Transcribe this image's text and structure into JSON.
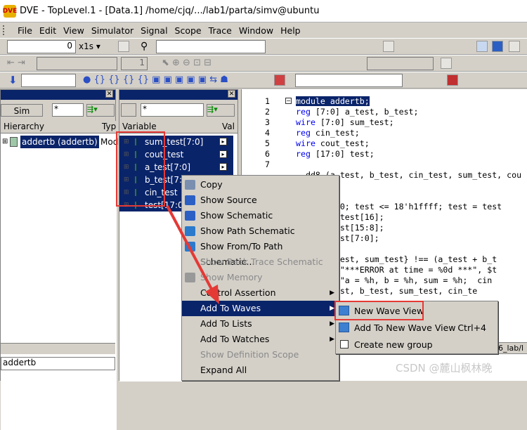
{
  "window": {
    "title": "DVE - TopLevel.1 - [Data.1]  /home/cjq/.../lab1/parta/simv@ubuntu",
    "logo": "DVE"
  },
  "menubar": [
    "File",
    "Edit",
    "View",
    "Simulator",
    "Signal",
    "Scope",
    "Trace",
    "Window",
    "Help"
  ],
  "toolbar1": {
    "time_value": "0",
    "time_unit": "x1s"
  },
  "toolbar2": {
    "step_value": "1"
  },
  "hierarchy": {
    "sim_label": "Sim",
    "filter": "*",
    "col_hierarchy": "Hierarchy",
    "col_type": "Typ",
    "row_name": "addertb (addertb)",
    "row_type": "Mod",
    "bottom_value": "addertb"
  },
  "variables": {
    "filter": "*",
    "col_variable": "Variable",
    "col_value": "Val",
    "rows": [
      "sum_test[7:0]",
      "cout_test",
      "a_test[7:0]",
      "b_test[7:0]",
      "cin_test",
      "test[17:0]"
    ]
  },
  "source": {
    "line_numbers": [
      "1",
      "2",
      "3",
      "4",
      "5",
      "6",
      "7"
    ],
    "lines": [
      {
        "kw": "",
        "text": "module addertb;"
      },
      {
        "kw": "reg",
        "text": " [7:0] a_test, b_test;"
      },
      {
        "kw": "wire",
        "text": " [7:0] sum_test;"
      },
      {
        "kw": "reg",
        "text": " cin_test;"
      },
      {
        "kw": "wire",
        "text": " cout_test;"
      },
      {
        "kw": "reg",
        "text": " [17:0] test;"
      },
      {
        "kw": "",
        "text": ""
      },
      {
        "kw": "",
        "text": "  dd8 (a_test, b_test, cin_test, sum_test, cou"
      },
      {
        "kw": "",
        "text": ""
      },
      {
        "kw": "",
        "text": ""
      },
      {
        "kw": "",
        "text": "   est = 0; test <= 18'h1ffff; test = test"
      },
      {
        "kw": "",
        "text": "   est = test[16];"
      },
      {
        "kw": "",
        "text": "   t = test[15:8];"
      },
      {
        "kw": "",
        "text": "   t = test[7:0];"
      },
      {
        "kw": "",
        "text": ""
      },
      {
        "kw": "",
        "text": "   cout_test, sum_test} !== (a_test + b_t"
      },
      {
        "kw": "",
        "text": "   splay(\"***ERROR at time = %0d ***\", $t"
      },
      {
        "kw": "",
        "text": "   splay(\"a = %h, b = %h, sum = %h;  cin"
      },
      {
        "kw": "",
        "text": "   , a_test, b_test, sum_test, cin_te"
      }
    ],
    "status_path": "6_lab/l"
  },
  "context_menu": [
    {
      "label": "Copy",
      "icon": "copy-icon",
      "enabled": true
    },
    {
      "label": "Show Source",
      "icon": "source-icon",
      "enabled": true
    },
    {
      "label": "Show Schematic",
      "icon": "schematic-icon",
      "enabled": true
    },
    {
      "label": "Show Path Schematic",
      "icon": "path-schematic-icon",
      "enabled": true
    },
    {
      "label": "Show From/To Path Schematic...",
      "icon": "fromto-schematic-icon",
      "enabled": true
    },
    {
      "label": "Show Back Trace Schematic",
      "icon": "",
      "enabled": false
    },
    {
      "label": "Show Memory",
      "icon": "memory-icon",
      "enabled": false
    },
    {
      "label": "Control Assertion",
      "icon": "",
      "enabled": true,
      "submenu": true
    },
    {
      "label": "Add To Waves",
      "icon": "",
      "enabled": true,
      "submenu": true,
      "highlighted": true
    },
    {
      "label": "Add To Lists",
      "icon": "",
      "enabled": true,
      "submenu": true
    },
    {
      "label": "Add To Watches",
      "icon": "",
      "enabled": true,
      "submenu": true
    },
    {
      "label": "Show Definition Scope",
      "icon": "",
      "enabled": false
    },
    {
      "label": "Expand All",
      "icon": "",
      "enabled": true
    }
  ],
  "submenu": [
    {
      "label": "New Wave View",
      "shortcut": "",
      "icon": "wave-icon"
    },
    {
      "label": "Add To New Wave View",
      "shortcut": "Ctrl+4",
      "icon": "wave-add-icon"
    },
    {
      "label": "Create new group",
      "shortcut": "",
      "icon": "checkbox-icon"
    }
  ],
  "watermark": "CSDN @麓山枫林晚",
  "colors": {
    "selection": "#0a246a",
    "annotation": "#e53935",
    "keyword": "#0000ee"
  }
}
